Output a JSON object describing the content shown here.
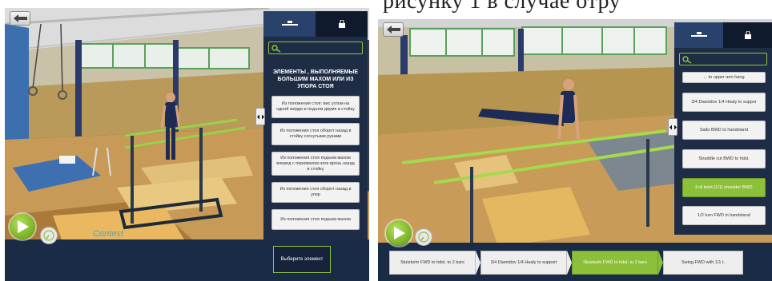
{
  "left_screen": {
    "back_button": {
      "icon": "arrow-left-icon"
    },
    "tabs": [
      {
        "icon": "apparatus-bars-icon",
        "active": true
      },
      {
        "icon": "lock-icon",
        "active": false
      }
    ],
    "search": {
      "icon": "search-icon",
      "value": ""
    },
    "panel_title": "ЭЛЕМЕНТЫ , ВЫПОЛНЯЕМЫЕ БОЛЬШИМ МАХОМ ИЛИ ИЗ УПОРА СТОЯ",
    "items": [
      {
        "label": "Из положения стоя: вис углом на одной жерди и подъем двумя в стойку"
      },
      {
        "label": "Из положения стоя оборот назад в стойку согнутыми руками"
      },
      {
        "label": "Из положения стоя подъем махом вперед с перемахом ноги врозь назад в стойку"
      },
      {
        "label": "Из положения стоя оборот назад в упор"
      },
      {
        "label": "Из положения стоя подъем махом"
      }
    ],
    "collapse_icon": "collapse-toggle-icon",
    "play_icon": "play-icon",
    "speed_icon": "speed-dial-icon",
    "choose_button": "Выберите элемент",
    "floor_logo": "Contest"
  },
  "right_screen": {
    "back_button": {
      "icon": "arrow-left-icon"
    },
    "tabs": [
      {
        "icon": "apparatus-bars-icon",
        "active": true
      },
      {
        "icon": "lock-icon",
        "active": false
      }
    ],
    "search": {
      "icon": "search-icon",
      "value": ""
    },
    "items": [
      {
        "label": "... to upper arm hang",
        "selected": false
      },
      {
        "label": "3/4 Diamidov 1/4 Healy to suppor",
        "selected": false
      },
      {
        "label": "Salto BWD to handstand",
        "selected": false
      },
      {
        "label": "Straddle cut BWD to hdst.",
        "selected": false
      },
      {
        "label": "Full twist (1/1) shoulder BWD",
        "selected": true
      },
      {
        "label": "1/2 turn FWD in handstand",
        "selected": false
      }
    ],
    "collapse_icon": "collapse-toggle-icon",
    "play_icon": "play-icon",
    "speed_icon": "speed-dial-icon",
    "sequence": [
      {
        "label": "Stutzkehr FWD to hdst. to 2 bars",
        "selected": false
      },
      {
        "label": "3/4 Diamidov 1/4 Healy to support",
        "selected": false
      },
      {
        "label": "Stutzkehr FWD to hdst. to 2 bars",
        "selected": true
      },
      {
        "label": "Swing FWD with 1/1 t.",
        "selected": false
      }
    ]
  },
  "colors": {
    "accent_green": "#8cbf3a",
    "panel_navy": "#1e2d45",
    "bar_navy": "#1a2b45"
  },
  "caption_partial": "рисунку 1 в случае отру"
}
